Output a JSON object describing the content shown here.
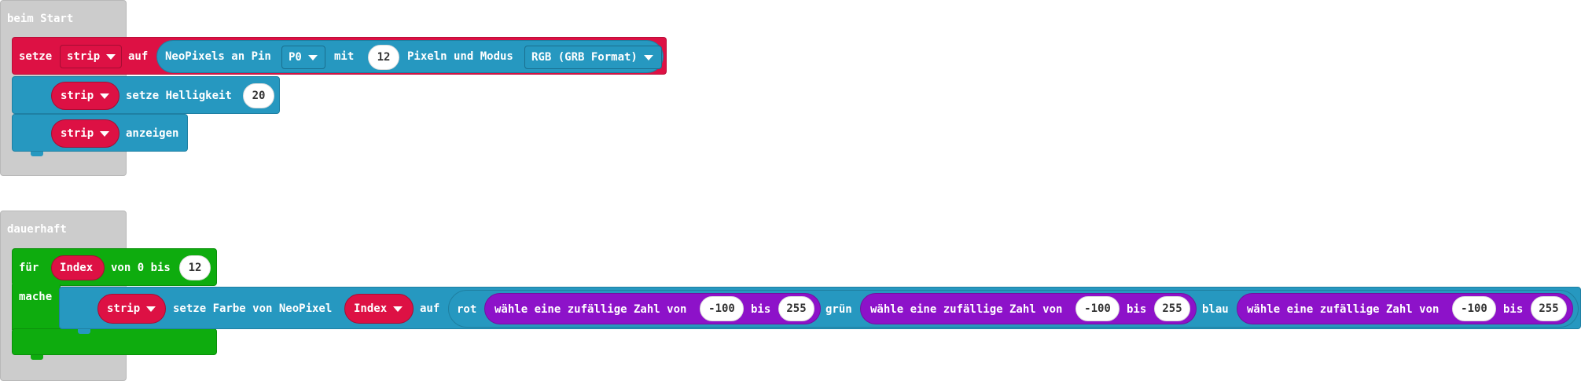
{
  "start_event": {
    "label": "beim Start",
    "set_block": {
      "keyword": "setze",
      "variable": "strip",
      "to": "auf",
      "create_text": "NeoPixels an Pin",
      "pin": "P0",
      "with": "mit",
      "pixel_count": "12",
      "mode_text": "Pixeln und Modus",
      "mode": "RGB (GRB Format)"
    },
    "brightness_block": {
      "variable": "strip",
      "action": "setze Helligkeit",
      "value": "20"
    },
    "show_block": {
      "variable": "strip",
      "action": "anzeigen"
    }
  },
  "forever_event": {
    "label": "dauerhaft",
    "for_block": {
      "keyword": "für",
      "variable": "Index",
      "range_text": "von 0 bis",
      "end_value": "12",
      "do_label": "mache"
    },
    "set_pixel_block": {
      "variable": "strip",
      "action": "setze Farbe von NeoPixel",
      "index_variable": "Index",
      "to": "auf",
      "rgb": {
        "red_label": "rot",
        "green_label": "grün",
        "blue_label": "blau",
        "random_text": "wähle eine zufällige Zahl von",
        "between": "bis",
        "red_min": "-100",
        "red_max": "255",
        "green_min": "-100",
        "green_max": "255",
        "blue_min": "-100",
        "blue_max": "255"
      }
    }
  },
  "colors": {
    "neopixel_red": "#dd1144",
    "neopixel_blue": "#2698c0",
    "loops_green": "#0eac0e",
    "math_purple": "#8d12c9",
    "event_gray": "#cccccc"
  },
  "icons": {
    "dropdown": "caret-down-icon"
  }
}
